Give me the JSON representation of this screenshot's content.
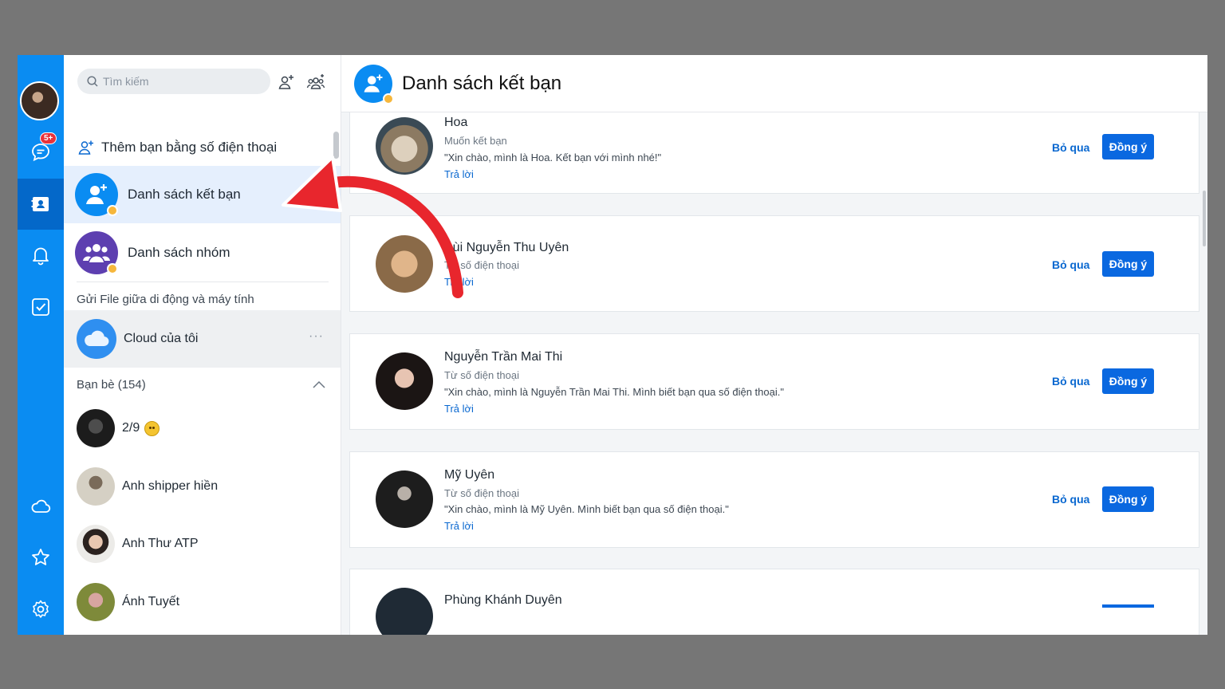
{
  "sidebar": {
    "search_placeholder": "Tìm kiếm",
    "add_by_phone": "Thêm bạn bằng số điện thoại",
    "menu": [
      {
        "label": "Danh sách kết bạn"
      },
      {
        "label": "Danh sách nhóm"
      }
    ],
    "file_section": "Gửi File giữa di động và máy tính",
    "cloud_label": "Cloud của tôi",
    "cloud_more": "···",
    "friends_header": "Bạn bè (154)",
    "friends": [
      {
        "name": "2/9"
      },
      {
        "name": "Anh shipper hiền"
      },
      {
        "name": "Anh Thư ATP"
      },
      {
        "name": "Ánh Tuyết"
      }
    ]
  },
  "rail": {
    "badge": "5+"
  },
  "main": {
    "title": "Danh sách kết bạn",
    "requests": [
      {
        "name": "Hoa",
        "source": "Muốn kết bạn",
        "message": "\"Xin chào, mình là Hoa. Kết bạn với mình nhé!\"",
        "reply": "Trả lời",
        "skip": "Bỏ qua",
        "accept": "Đồng ý"
      },
      {
        "name": "Bùi Nguyễn Thu Uyên",
        "source": "Từ số điện thoại",
        "message": "",
        "reply": "Trả lời",
        "skip": "Bỏ qua",
        "accept": "Đồng ý"
      },
      {
        "name": "Nguyễn Trần Mai Thi",
        "source": "Từ số điện thoại",
        "message": "\"Xin chào, mình là Nguyễn Trần Mai Thi. Mình biết bạn qua số điện thoại.\"",
        "reply": "Trả lời",
        "skip": "Bỏ qua",
        "accept": "Đồng ý"
      },
      {
        "name": "Mỹ Uyên",
        "source": "Từ số điện thoại",
        "message": "\"Xin chào, mình là Mỹ Uyên. Mình biết bạn qua số điện thoại.\"",
        "reply": "Trả lời",
        "skip": "Bỏ qua",
        "accept": "Đồng ý"
      },
      {
        "name": "Phùng Khánh Duyên"
      }
    ]
  },
  "colors": {
    "rail": "#0a8cf2",
    "accent": "#0a68e0",
    "arrow": "#e8262d"
  }
}
